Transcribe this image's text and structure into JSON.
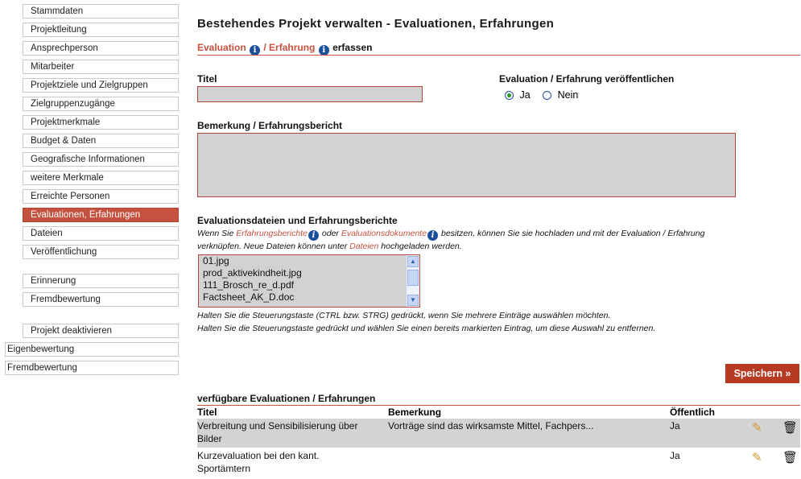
{
  "sidebar": {
    "items": [
      {
        "label": "Stammdaten"
      },
      {
        "label": "Projektleitung"
      },
      {
        "label": "Ansprechperson"
      },
      {
        "label": "Mitarbeiter"
      },
      {
        "label": "Projektziele und Zielgruppen"
      },
      {
        "label": "Zielgruppenzugänge"
      },
      {
        "label": "Projektmerkmale"
      },
      {
        "label": "Budget & Daten"
      },
      {
        "label": "Geografische Informationen"
      },
      {
        "label": "weitere Merkmale"
      },
      {
        "label": "Erreichte Personen"
      },
      {
        "label": "Evaluationen, Erfahrungen"
      },
      {
        "label": "Dateien"
      },
      {
        "label": "Veröffentlichung"
      }
    ],
    "group2": [
      {
        "label": "Erinnerung"
      },
      {
        "label": "Fremdbewertung"
      }
    ],
    "deactivate": "Projekt deaktivieren",
    "eigenbewertung": "Eigenbewertung",
    "fremdbewertung_top": "Fremdbewertung",
    "accent_color": "#c5523f"
  },
  "main": {
    "title": "Bestehendes Projekt verwalten - Evaluationen, Erfahrungen",
    "subhead": {
      "evaluation": "Evaluation",
      "slash": " / ",
      "erfahrung": "Erfahrung",
      "suffix": "erfassen"
    },
    "titel_label": "Titel",
    "titel_value": "",
    "publish_label": "Evaluation / Erfahrung veröffentlichen",
    "radio_yes": "Ja",
    "radio_no": "Nein",
    "radio_selected": "Ja",
    "bemerkung_label": "Bemerkung / Erfahrungsbericht",
    "bemerkung_value": "",
    "files_label": "Evaluationsdateien und Erfahrungsberichte",
    "files_help": {
      "p1": "Wenn Sie ",
      "link1": "Erfahrungsberichte",
      "p2": " oder ",
      "link2": "Evaluationsdokumente",
      "p3": " besitzen, können Sie sie hochladen und mit der Evaluation / Erfahrung",
      "p4": "verknüpfen. Neue Dateien können unter ",
      "link3": "Dateien",
      "p5": " hochgeladen werden."
    },
    "files_options": [
      "01.jpg",
      "prod_aktivekindheit.jpg",
      "111_Brosch_re_d.pdf",
      "Factsheet_AK_D.doc"
    ],
    "hint1": "Halten Sie die Steuerungstaste (CTRL bzw. STRG) gedrückt, wenn Sie mehrere Einträge auswählen möchten.",
    "hint2": "Halten Sie die Steuerungstaste gedrückt und wählen Sie einen bereits markierten Eintrag, um diese Auswahl zu entfernen.",
    "save_label": "Speichern »",
    "table": {
      "heading": "verfügbare Evaluationen / Erfahrungen",
      "columns": [
        "Titel",
        "Bemerkung",
        "Öffentlich"
      ],
      "rows": [
        {
          "titel_l1": "Verbreitung und Sensibilisierung über",
          "titel_l2": "Bilder",
          "bemerkung": "Vorträge sind das wirksamste Mittel, Fachpers...",
          "oeffentlich": "Ja"
        },
        {
          "titel_l1": "Kurzevaluation bei den kant.",
          "titel_l2": "Sportämtern",
          "bemerkung": "",
          "oeffentlich": "Ja"
        }
      ]
    }
  }
}
